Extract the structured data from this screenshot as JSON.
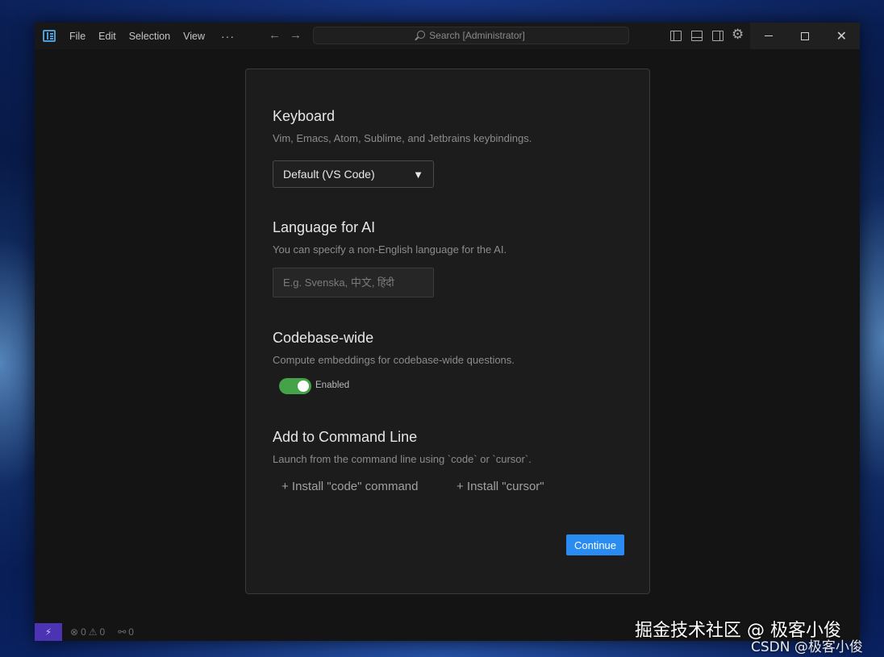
{
  "titlebar": {
    "menu": [
      "File",
      "Edit",
      "Selection",
      "View"
    ],
    "more": "···",
    "search_placeholder": "Search [Administrator]",
    "icons": [
      "app-logo-icon",
      "arrow-left-icon",
      "arrow-right-icon",
      "search-icon",
      "toggle-primary-sidebar-icon",
      "toggle-panel-icon",
      "toggle-secondary-sidebar-icon",
      "gear-icon",
      "minimize-icon",
      "maximize-icon",
      "close-icon"
    ]
  },
  "dialog": {
    "keyboard": {
      "title": "Keyboard",
      "description": "Vim, Emacs, Atom, Sublime, and Jetbrains keybindings.",
      "selected": "Default (VS Code)"
    },
    "language": {
      "title": "Language for AI",
      "description": "You can specify a non-English language for the AI.",
      "placeholder": "E.g. Svenska, 中文, हिंदी",
      "value": ""
    },
    "codebase": {
      "title": "Codebase-wide",
      "description": "Compute embeddings for codebase-wide questions.",
      "toggle_label": "Enabled",
      "enabled": true
    },
    "command_line": {
      "title": "Add to Command Line",
      "description": "Launch from the command line using `code` or `cursor`.",
      "install_code": "+ Install \"code\" command",
      "install_cursor": "+ Install \"cursor\""
    },
    "continue_label": "Continue"
  },
  "statusbar": {
    "remote_icon": "remote-icon",
    "errors": "0",
    "warnings": "0",
    "ports": "0"
  },
  "watermark": {
    "line1": "掘金技术社区 @ 极客小俊",
    "line2": "CSDN @极客小俊"
  },
  "colors": {
    "accent": "#2a8cf0",
    "toggle_on": "#44a248",
    "remote": "#4b33b4",
    "dialog_bg": "#1c1c1c"
  }
}
